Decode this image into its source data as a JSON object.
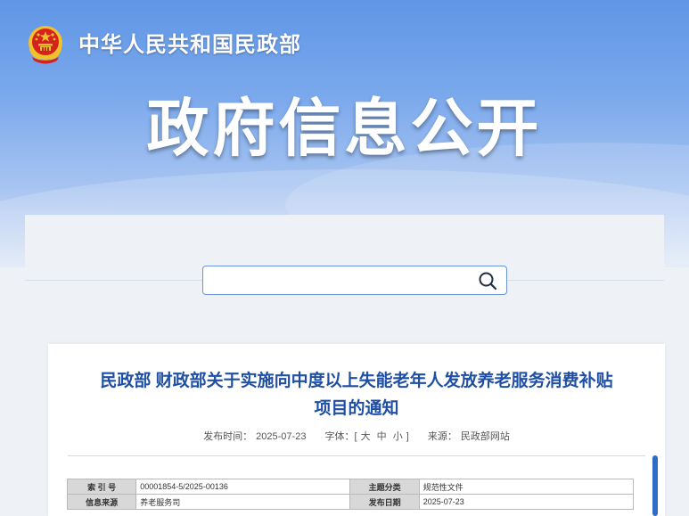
{
  "header": {
    "ministry_name": "中华人民共和国民政部",
    "banner_title": "政府信息公开"
  },
  "search": {
    "placeholder": "",
    "value": ""
  },
  "article": {
    "title_line1": "民政部 财政部关于实施向中度以上失能老年人发放养老服务消费补贴",
    "title_line2": "项目的通知",
    "publish_label": "发布时间：",
    "publish_date": "2025-07-23",
    "font_label": "字体：[",
    "font_large": "大",
    "font_medium": "中",
    "font_small": "小",
    "font_close": "]",
    "source_label": "来源：",
    "source_value": "民政部网站"
  },
  "info_table": {
    "rows": [
      {
        "label1": "索 引 号",
        "value1": "00001854-5/2025-00136",
        "label2": "主题分类",
        "value2": "规范性文件"
      },
      {
        "label1": "信息来源",
        "value1": "养老服务司",
        "label2": "发布日期",
        "value2": "2025-07-23"
      }
    ]
  },
  "colors": {
    "title_blue": "#1f4fa5",
    "accent_blue": "#2e6cc7",
    "emblem_red": "#d4231e",
    "emblem_gold": "#f2c12e"
  },
  "icons": {
    "emblem": "national-emblem-icon",
    "search": "search-icon"
  }
}
